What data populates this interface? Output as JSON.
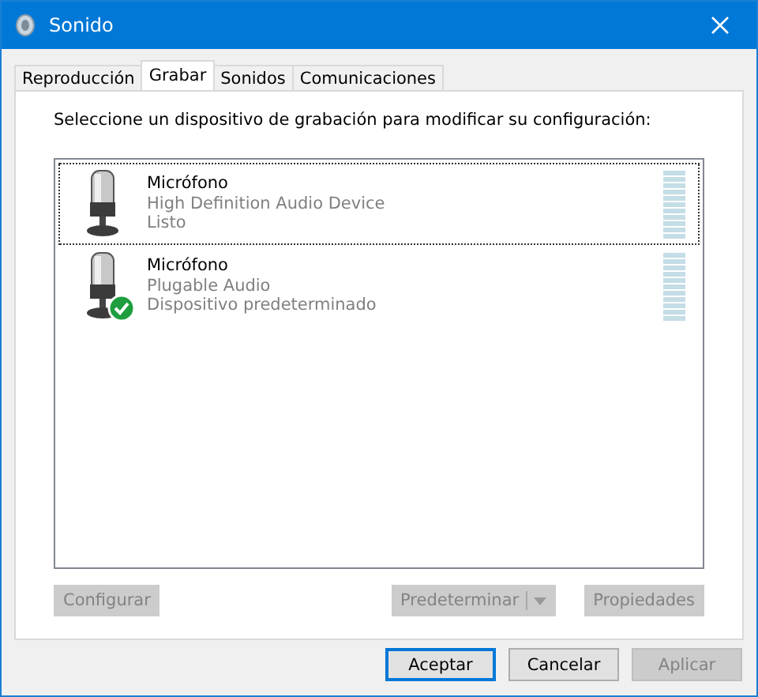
{
  "window": {
    "title": "Sonido"
  },
  "tabs": [
    {
      "label": "Reproducción",
      "selected": false
    },
    {
      "label": "Grabar",
      "selected": true
    },
    {
      "label": "Sonidos",
      "selected": false
    },
    {
      "label": "Comunicaciones",
      "selected": false
    }
  ],
  "instruction": "Seleccione un dispositivo de grabación para modificar su configuración:",
  "devices": [
    {
      "name": "Micrófono",
      "description": "High Definition Audio Device",
      "status": "Listo",
      "selected": true,
      "default": false
    },
    {
      "name": "Micrófono",
      "description": "Plugable Audio",
      "status": "Dispositivo predeterminado",
      "selected": false,
      "default": true
    }
  ],
  "device_buttons": [
    {
      "label": "Configurar",
      "disabled": true,
      "kind": "plain"
    },
    {
      "label": "Predeterminar",
      "disabled": true,
      "kind": "split"
    },
    {
      "label": "Propiedades",
      "disabled": true,
      "kind": "plain"
    }
  ],
  "dialog_buttons": [
    {
      "label": "Aceptar",
      "disabled": false,
      "focused": true
    },
    {
      "label": "Cancelar",
      "disabled": false,
      "focused": false
    },
    {
      "label": "Aplicar",
      "disabled": true,
      "focused": false
    }
  ]
}
